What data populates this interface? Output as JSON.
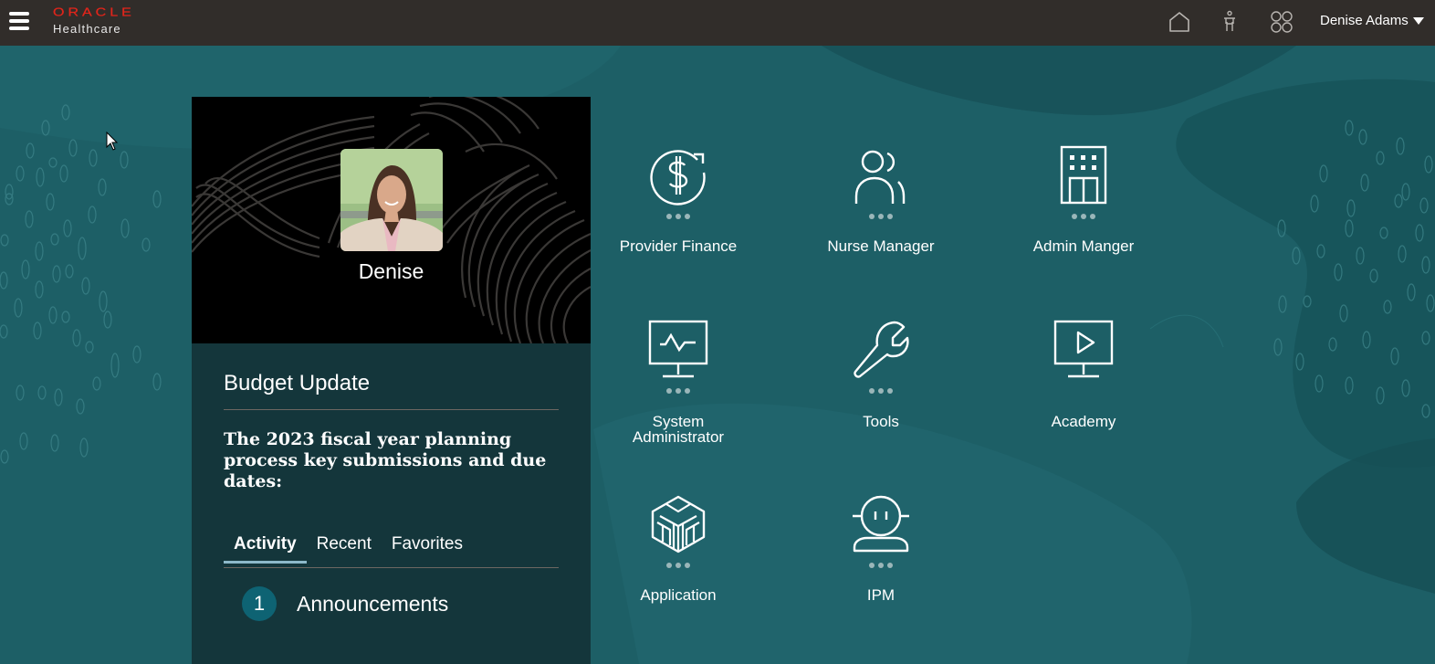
{
  "header": {
    "brand_name": "ORACLE",
    "brand_sub": "Healthcare",
    "icons": [
      "menu-icon",
      "home-icon",
      "accessibility-icon",
      "apps-grid-icon"
    ],
    "user_name": "Denise Adams"
  },
  "profile": {
    "name": "Denise"
  },
  "announcement_panel": {
    "title": "Budget Update",
    "body": "The 2023 fiscal year planning process  key submissions and due dates:",
    "tabs": [
      {
        "label": "Activity",
        "active": true
      },
      {
        "label": "Recent",
        "active": false
      },
      {
        "label": "Favorites",
        "active": false
      }
    ],
    "activity": {
      "count": "1",
      "label": "Announcements"
    }
  },
  "apps": [
    {
      "label": "Provider Finance",
      "icon": "dollar-refresh-icon",
      "has_menu": true
    },
    {
      "label": "Nurse Manager",
      "icon": "people-icon",
      "has_menu": true
    },
    {
      "label": "Admin Manger",
      "icon": "building-icon",
      "has_menu": true
    },
    {
      "label": "System Administrator",
      "icon": "monitor-pulse-icon",
      "has_menu": true
    },
    {
      "label": "Tools",
      "icon": "wrench-icon",
      "has_menu": true
    },
    {
      "label": "Academy",
      "icon": "monitor-play-icon",
      "has_menu": false
    },
    {
      "label": "Application",
      "icon": "cube-icon",
      "has_menu": true
    },
    {
      "label": "IPM",
      "icon": "robot-icon",
      "has_menu": true
    }
  ],
  "colors": {
    "header_bg": "#312d2a",
    "brand_red": "#e1251b",
    "page_bg": "#1d5f66",
    "panel_bg": "#14363b",
    "tab_underline": "#8db9ca",
    "badge_bg": "#0e6373"
  }
}
